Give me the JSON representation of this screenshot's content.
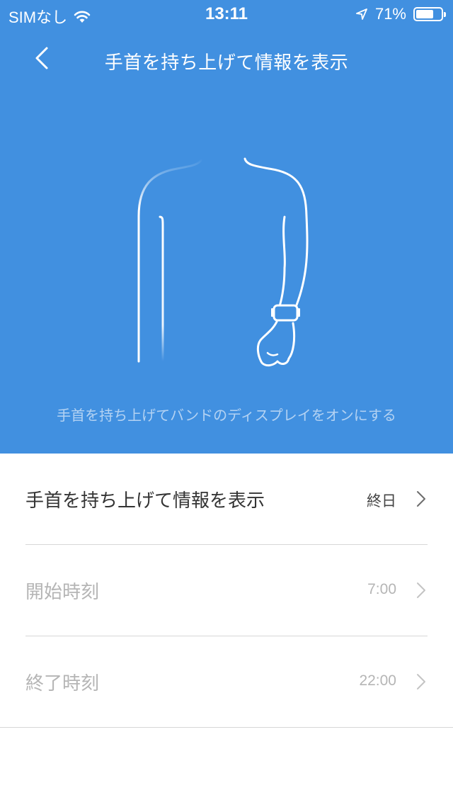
{
  "status_bar": {
    "carrier": "SIMなし",
    "time": "13:11",
    "battery_percent": "71%",
    "battery_level": 0.71,
    "icons": [
      "wifi-icon",
      "location-arrow-icon",
      "battery-icon"
    ]
  },
  "nav": {
    "title": "手首を持ち上げて情報を表示",
    "back_icon": "chevron-left-icon"
  },
  "hero": {
    "caption": "手首を持ち上げてバンドのディスプレイをオンにする",
    "illustration": "person-raising-wrist-with-band"
  },
  "settings": [
    {
      "label": "手首を持ち上げて情報を表示",
      "value": "終日",
      "enabled": true
    },
    {
      "label": "開始時刻",
      "value": "7:00",
      "enabled": false
    },
    {
      "label": "終了時刻",
      "value": "22:00",
      "enabled": false
    }
  ],
  "colors": {
    "accent": "#4190e0",
    "text_primary": "#333333",
    "text_disabled": "#b5b5b5",
    "divider": "#d7d7d7"
  }
}
